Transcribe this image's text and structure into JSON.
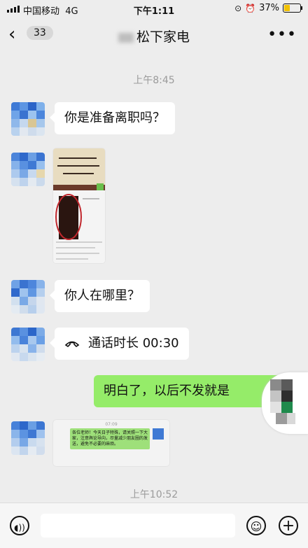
{
  "status_bar": {
    "carrier": "中国移动",
    "network": "4G",
    "time": "下午1:11",
    "battery": "37%",
    "battery_level": 0.37
  },
  "nav": {
    "back_icon": "chevron-left",
    "unread_badge": "33",
    "chat_title": "松下家电",
    "more_icon": "ellipsis"
  },
  "messages": {
    "time1": "上午8:45",
    "msg1": "你是准备离职吗？",
    "msg3": "你人在哪里？",
    "call_icon": "phone-hangup",
    "call_text": "通话时长 00:30",
    "msg_me": "明白了，以后不发就是",
    "time2": "上午10:52",
    "image_caption": "各位老师！今天日子特殊，请关照一下大家，注意舆论导向，尽量减少朋友圈的发送，避免不必要的麻烦。",
    "image_caption_time": "07:09"
  },
  "bottom_bar": {
    "voice_icon": "voice",
    "emoji_icon": "smile",
    "plus_icon": "plus",
    "plus_label": "+"
  },
  "colors": {
    "background": "#ededed",
    "my_bubble": "#95ec69",
    "their_bubble": "#ffffff"
  }
}
